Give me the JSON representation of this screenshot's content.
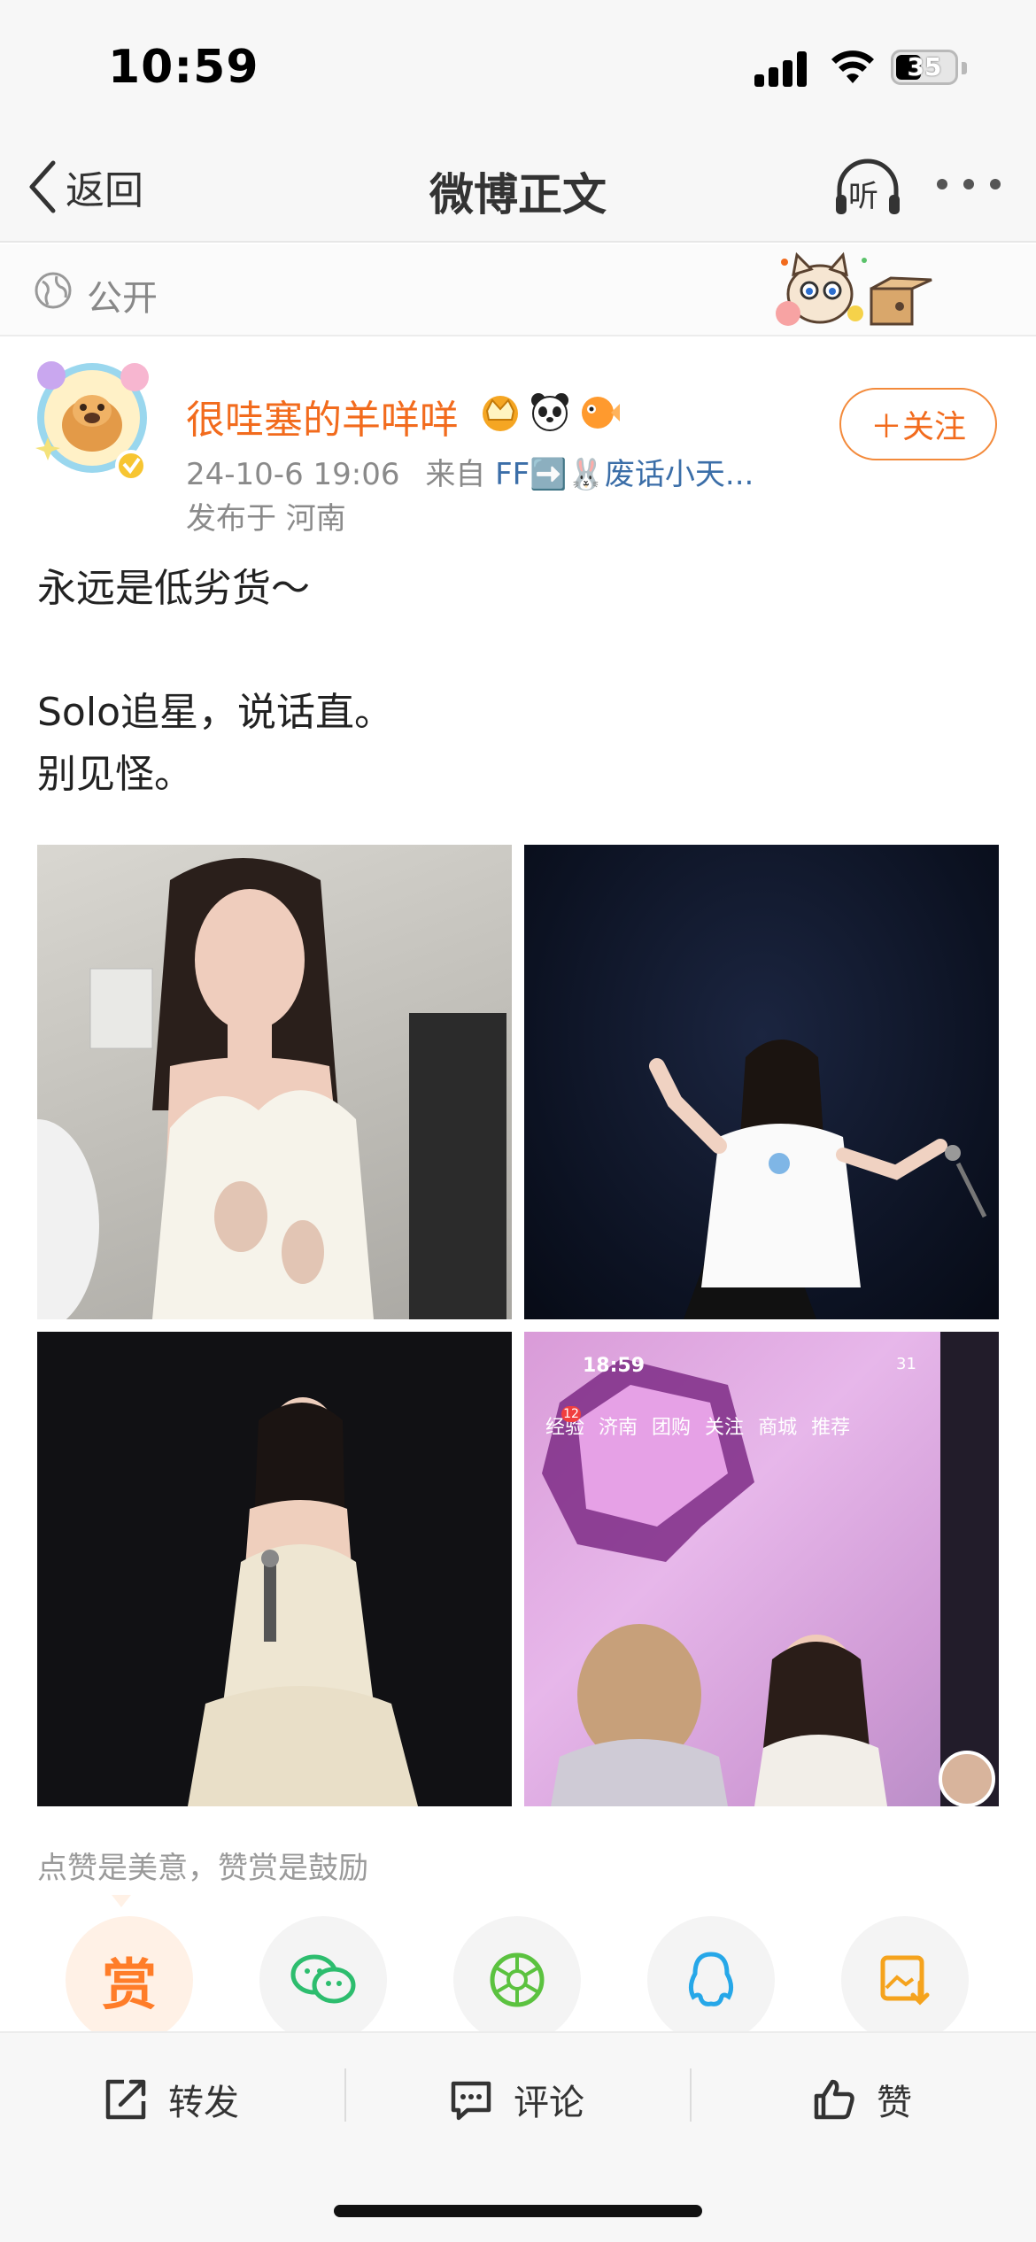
{
  "status_bar": {
    "time": "10:59",
    "battery": "35"
  },
  "nav": {
    "back_label": "返回",
    "title": "微博正文",
    "listen_label": "听"
  },
  "visibility": {
    "label": "公开"
  },
  "author": {
    "name": "很哇塞的羊咩咩",
    "date": "24-10-6 19:06",
    "source_prefix": "来自",
    "source": "FF➡️🐰废话小天...",
    "location": "发布于 河南",
    "follow_label": "＋关注",
    "badges": [
      "crown-icon",
      "panda-icon",
      "fish-icon"
    ]
  },
  "post": {
    "lines": [
      "永远是低劣货～",
      "",
      "Solo追星，说话直。",
      "别见怪。"
    ]
  },
  "photos": {
    "p4_time": "18:59",
    "p4_tabs": [
      "经验",
      "济南",
      "团购",
      "关注",
      "商城",
      "推荐"
    ],
    "p4_badge": "12",
    "p4_battery": "31"
  },
  "caption": "点赞是美意，赞赏是鼓励",
  "share": {
    "reward_label": "赏"
  },
  "toolbar": {
    "repost": "转发",
    "comment": "评论",
    "like": "赞"
  },
  "colors": {
    "accent": "#f26b1d",
    "link": "#3b6ea8"
  }
}
